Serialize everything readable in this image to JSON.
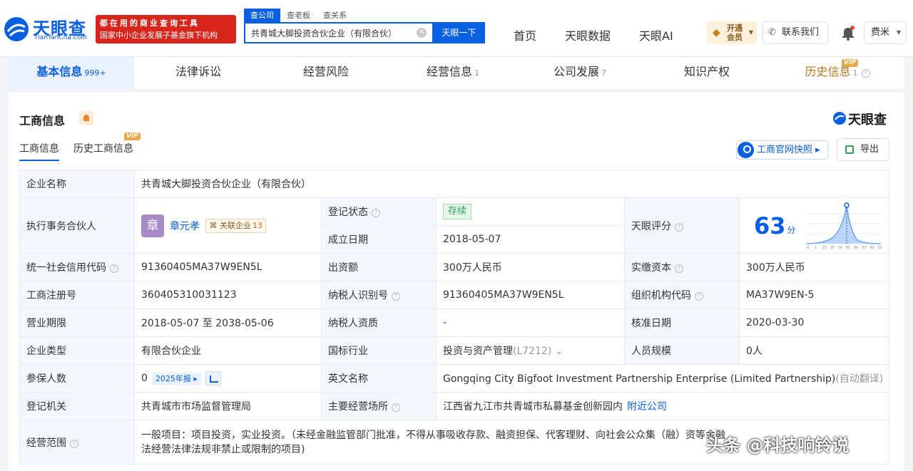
{
  "header": {
    "logo_cn": "天眼查",
    "logo_en": "TianYanCha.com",
    "slogan_line1": "都在用的商业查询工具",
    "slogan_line2": "国家中小企业发展子基金旗下机构",
    "search_tabs": [
      "查公司",
      "查老板",
      "查关系"
    ],
    "search_value": "共青城大脚投资合伙企业（有限合伙）",
    "search_button": "天眼一下",
    "nav": [
      "首页",
      "天眼数据",
      "天眼AI"
    ],
    "vip_line1": "开通",
    "vip_line2": "会员",
    "contact": "联系我们",
    "user": "费米"
  },
  "tabs": [
    {
      "label": "基本信息",
      "count": "999+"
    },
    {
      "label": "法律诉讼",
      "count": ""
    },
    {
      "label": "经营风险",
      "count": ""
    },
    {
      "label": "经营信息",
      "count": "1"
    },
    {
      "label": "公司发展",
      "count": "7"
    },
    {
      "label": "知识产权",
      "count": ""
    },
    {
      "label": "历史信息",
      "count": "1"
    }
  ],
  "vip_tag": "VIP",
  "section": {
    "title": "工商信息",
    "brand": "天眼查",
    "subtabs": [
      "工商信息",
      "历史工商信息"
    ],
    "snapshot_button": "工商官网快照",
    "export_button": "导出"
  },
  "info": {
    "company_name_label": "企业名称",
    "company_name": "共青城大脚投资合伙企业（有限合伙）",
    "partner_label": "执行事务合伙人",
    "partner_avatar": "章",
    "partner_name": "章元孝",
    "partner_rel_label": "关联企业",
    "partner_rel_count": "13",
    "reg_status_label": "登记状态",
    "reg_status": "存续",
    "found_date_label": "成立日期",
    "found_date": "2018-05-07",
    "score_label": "天眼评分",
    "score": "63",
    "score_unit": "分",
    "credit_code_label": "统一社会信用代码",
    "credit_code": "91360405MA37W9EN5L",
    "contribution_label": "出资额",
    "contribution": "300万人民币",
    "paid_capital_label": "实缴资本",
    "paid_capital": "300万人民币",
    "reg_no_label": "工商注册号",
    "reg_no": "360405310031123",
    "taxpayer_id_label": "纳税人识别号",
    "taxpayer_id": "91360405MA37W9EN5L",
    "org_code_label": "组织机构代码",
    "org_code": "MA37W9EN-5",
    "term_label": "营业期限",
    "term": "2018-05-07 至 2038-05-06",
    "taxpayer_qual_label": "纳税人资质",
    "taxpayer_qual": "-",
    "approve_date_label": "核准日期",
    "approve_date": "2020-03-30",
    "company_type_label": "企业类型",
    "company_type": "有限合伙企业",
    "industry_label": "国标行业",
    "industry": "投资与资产管理",
    "industry_code": "(L7212)",
    "staff_size_label": "人员规模",
    "staff_size": "0人",
    "insured_label": "参保人数",
    "insured": "0",
    "insured_year": "2025年报",
    "english_name_label": "英文名称",
    "english_name": "Gongqing City Bigfoot Investment Partnership Enterprise (Limited Partnership)",
    "english_name_note": "(自动翻译)",
    "authority_label": "登记机关",
    "authority": "共青城市市场监督管理局",
    "address_label": "主要经营场所",
    "address": "江西省九江市共青城市私募基金创新园内",
    "nearby_link": "附近公司",
    "scope_label": "经营范围",
    "scope_line1": "一般项目：项目投资，实业投资。（未经金融监管部门批准，不得从事吸收存款、融资担保、代客理财、向社会公众集（融）资等金融",
    "scope_line2": "法经营法律法规非禁止或限制的项目)"
  },
  "score_chart": {
    "ticks": [
      "0",
      "1",
      "15",
      "35",
      "50",
      "65",
      "80",
      "97",
      "99",
      "100"
    ]
  },
  "watermark": "头条 @科技响铃说",
  "colors": {
    "primary": "#0a60e0",
    "slogan_bg": "#d8251c",
    "status_green": "#2aa05a",
    "history": "#b5771e"
  }
}
